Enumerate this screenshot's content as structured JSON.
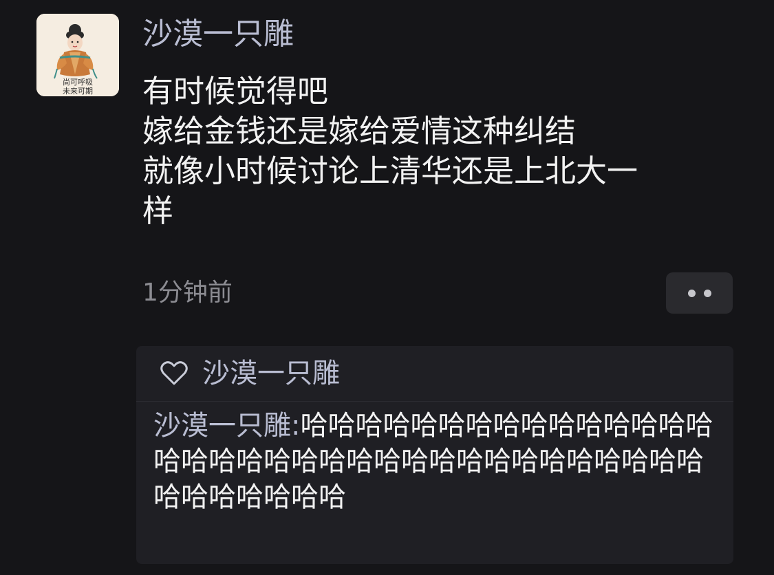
{
  "post": {
    "avatar": {
      "caption_line1": "尚可呼吸",
      "caption_line2": "未来可期"
    },
    "username": "沙漠一只雕",
    "lines": [
      "有时候觉得吧",
      "嫁给金钱还是嫁给爱情这种纠结",
      "就像小时候讨论上清华还是上北大一",
      "样"
    ],
    "timestamp": "1分钟前",
    "more_icon": "more-dots-icon"
  },
  "reply_section": {
    "like_icon": "heart-outline-icon",
    "liker_name": "沙漠一只雕",
    "comment": {
      "author": "沙漠一只雕:",
      "text": "哈哈哈哈哈哈哈哈哈哈哈哈哈哈哈哈哈哈哈哈哈哈哈哈哈哈哈哈哈哈哈哈哈哈哈哈哈哈哈哈哈哈"
    }
  },
  "colors": {
    "background": "#151518",
    "username": "#b9bdd2",
    "text": "#f2f2f2",
    "muted": "#8c8c92",
    "card": "#1f1f24"
  }
}
